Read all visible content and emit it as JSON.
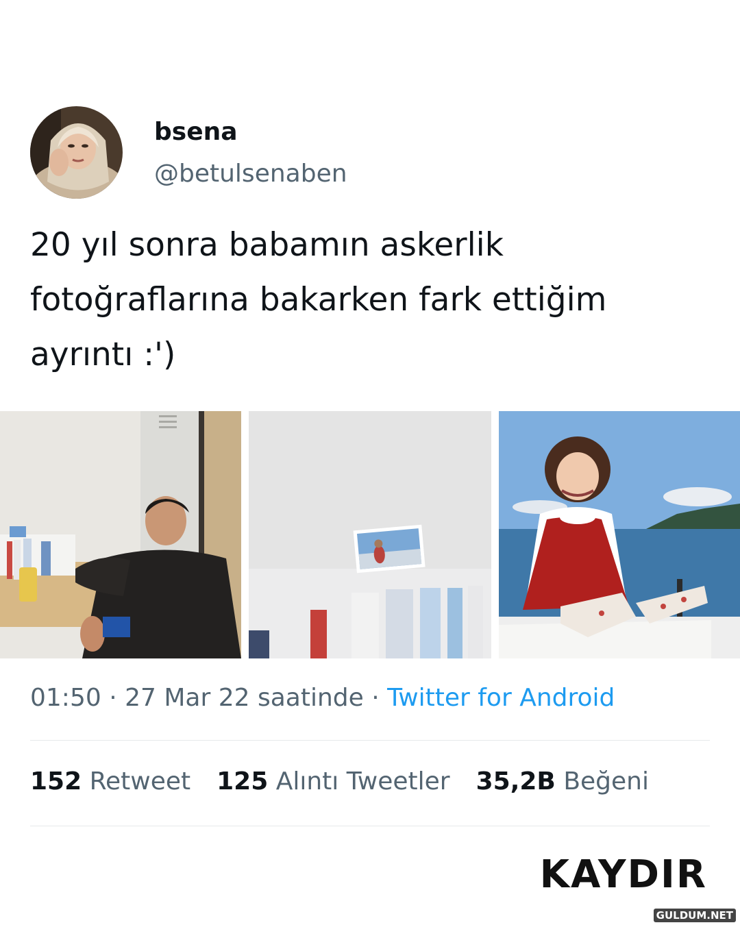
{
  "tweet": {
    "display_name": "bsena",
    "handle": "@betulsenaben",
    "text_lines": [
      "20 yıl sonra babamın askerlik",
      "fotoğraflarına bakarken fark ettiğim",
      "ayrıntı :')"
    ],
    "time": "01:50",
    "date": "27 Mar 22 saatinde",
    "separator": "·",
    "source": "Twitter for Android",
    "stats": {
      "retweets_count": "152",
      "retweets_label": "Retweet",
      "quotes_count": "125",
      "quotes_label": "Alıntı Tweetler",
      "likes_count": "35,2B",
      "likes_label": "Beğeni"
    }
  },
  "photos": [
    {
      "subject": "man-at-desk-photo"
    },
    {
      "subject": "zoomed-small-photo-on-books"
    },
    {
      "subject": "girl-by-sea-photo"
    }
  ],
  "overlay": {
    "cta": "KAYDIR",
    "watermark": "GULDUM.NET"
  },
  "colors": {
    "text": "#0f1419",
    "secondary": "#536471",
    "link": "#1d9bf0"
  }
}
